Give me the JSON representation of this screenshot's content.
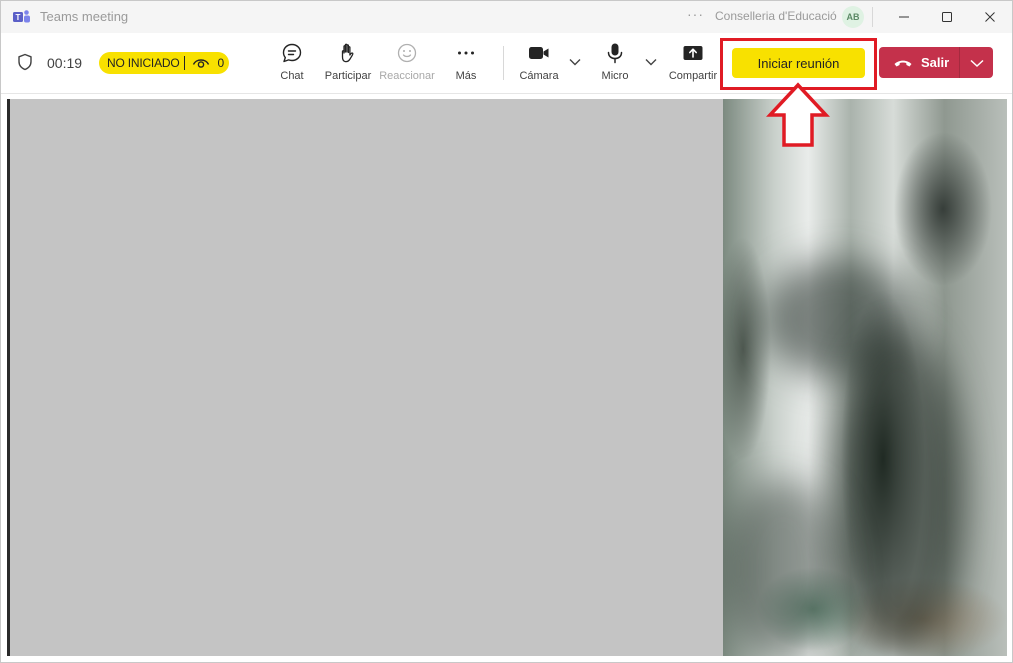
{
  "window": {
    "title": "Teams meeting",
    "more": "···",
    "organization": "Conselleria d'Educació",
    "avatar_initials": "AB"
  },
  "toolbar": {
    "timer": "00:19",
    "status": "NO INICIADO",
    "viewer_count": "0",
    "chat_label": "Chat",
    "participate_label": "Participar",
    "react_label": "Reaccionar",
    "more_label": "Más",
    "camera_label": "Cámara",
    "mic_label": "Micro",
    "share_label": "Compartir",
    "start_label": "Iniciar reunión",
    "leave_label": "Salir"
  },
  "colors": {
    "accent_yellow": "#f8e100",
    "leave_red": "#c4314b",
    "annotation_red": "#e01b24",
    "placeholder_gray": "#c4c4c4"
  },
  "icons": [
    "teams-logo-icon",
    "shield-icon",
    "eye-icon",
    "chat-icon",
    "hand-icon",
    "smiley-icon",
    "ellipsis-icon",
    "camera-icon",
    "microphone-icon",
    "share-icon",
    "phone-hangup-icon",
    "chevron-down-icon",
    "minimize-icon",
    "maximize-icon",
    "close-icon",
    "arrow-up-annotation"
  ]
}
